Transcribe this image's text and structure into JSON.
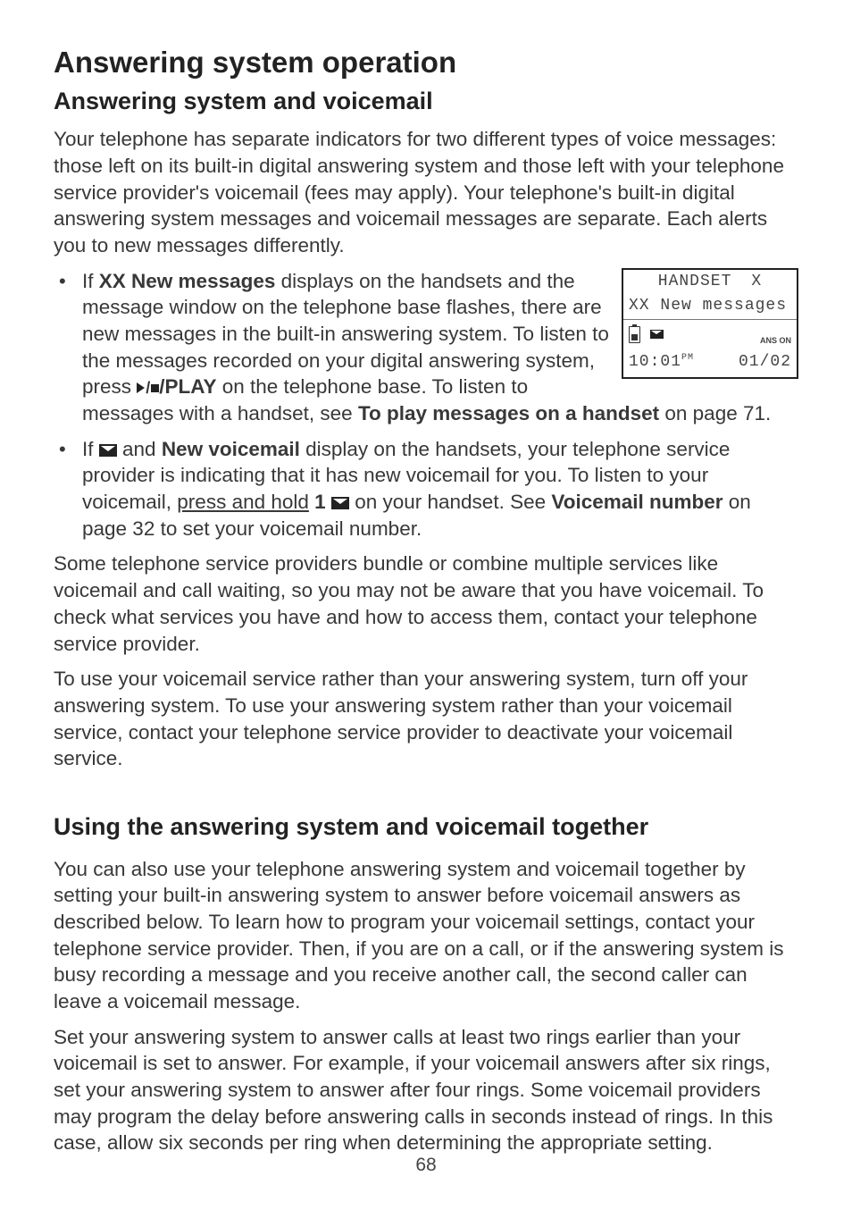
{
  "title": "Answering system operation",
  "section1": {
    "heading": "Answering system and voicemail",
    "intro": "Your telephone has separate indicators for two different types of voice messages: those left on its built-in digital answering system and those left with your telephone service provider's voicemail (fees may apply). Your telephone's built-in digital answering system messages and voicemail messages are separate. Each alerts you to new messages differently.",
    "bullet1": {
      "pre": "If ",
      "bold1": "XX New messages",
      "mid1": " displays on the handsets and the message window on the telephone base flashes, there are new messages in the built-in answering system. To listen to the messages recorded on your digital answering system, press ",
      "bold2": "/PLAY",
      "mid2": " on the telephone base. To listen to messages with a handset, see ",
      "bold3": "To play messages on a handset",
      "tail": " on page 71."
    },
    "bullet2": {
      "pre": "If ",
      "mid1": " and ",
      "bold1": "New voicemail",
      "mid2": " display on the handsets, your telephone service provider is indicating that it has new voicemail for you. To listen to your voicemail, ",
      "under1": "press and hold",
      "mid3": " ",
      "bold2": "1",
      "mid4": " ",
      "mid5": " on your handset. See ",
      "bold3": "Voicemail number",
      "tail": " on page 32 to set your voicemail number."
    },
    "para2": "Some telephone service providers bundle or combine multiple services like voicemail and call waiting, so you may not be aware that you have voicemail. To check what services you have and how to access them, contact your telephone service provider.",
    "para3": "To use your voicemail service rather than your answering system, turn off your answering system. To use your answering system rather than your voicemail service, contact your telephone service provider to deactivate your voicemail service."
  },
  "section2": {
    "heading": "Using the answering system and voicemail together",
    "para1": "You can also use your telephone answering system and voicemail together by setting your built-in answering system to answer before voicemail answers as described below. To learn how to program your voicemail settings, contact your telephone service provider. Then, if you are on a call, or if the answering system is busy recording a message and you receive another call, the second caller can leave a voicemail message.",
    "para2": "Set your answering system to answer calls at least two rings earlier than your voicemail is set to answer. For example, if your voicemail answers after six rings, set your answering system to answer after four rings. Some voicemail providers may program the delay before answering calls in seconds instead of rings. In this case, allow six seconds per ring when determining the appropriate setting."
  },
  "display": {
    "line1a": "HANDSET",
    "line1b": "X",
    "line2": "XX New messages",
    "line3b": "ANS ON",
    "line4a": "10:01",
    "line4a_ampm": "PM",
    "line4b": "01/02"
  },
  "page_number": "68"
}
